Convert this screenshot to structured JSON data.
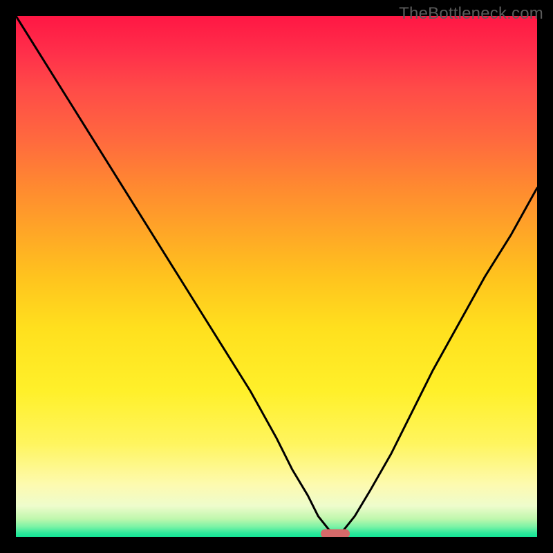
{
  "watermark": "TheBottleneck.com",
  "chart_data": {
    "type": "line",
    "title": "",
    "xlabel": "",
    "ylabel": "",
    "xlim": [
      0,
      100
    ],
    "ylim": [
      0,
      100
    ],
    "axes_visible": false,
    "grid": false,
    "background": "heatmap-gradient",
    "gradient_stops": [
      {
        "pct": 0,
        "color": "#ff1744"
      },
      {
        "pct": 50,
        "color": "#ffc31e"
      },
      {
        "pct": 90,
        "color": "#fdfab0"
      },
      {
        "pct": 100,
        "color": "#12e596"
      }
    ],
    "series": [
      {
        "name": "bottleneck-curve",
        "color": "#000000",
        "stroke_width": 3,
        "x": [
          0,
          5,
          10,
          15,
          20,
          25,
          30,
          35,
          40,
          45,
          50,
          53,
          56,
          58,
          60,
          61.5,
          63,
          65,
          68,
          72,
          76,
          80,
          85,
          90,
          95,
          100
        ],
        "y": [
          100,
          92,
          84,
          76,
          68,
          60,
          52,
          44,
          36,
          28,
          19,
          13,
          8,
          4,
          1.5,
          0.5,
          1.5,
          4,
          9,
          16,
          24,
          32,
          41,
          50,
          58,
          67
        ]
      }
    ],
    "marker": {
      "type": "pill",
      "x": 61.3,
      "y": 0.6,
      "color": "#d56a6a",
      "label": ""
    },
    "notes": "V-shaped curve over vertical red→yellow→green gradient; minimum near x≈61.5. No numeric axis labels are visible in the source image; x and y values are estimated relative coordinates (0–100)."
  }
}
